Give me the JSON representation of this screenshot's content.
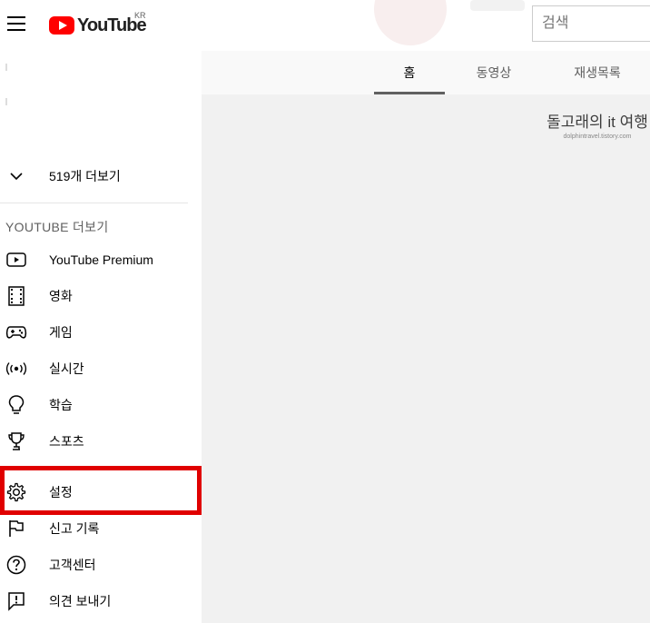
{
  "masthead": {
    "logo_text": "YouTube",
    "country_code": "KR",
    "search_placeholder": "검색"
  },
  "tabs": [
    {
      "label": "홈",
      "active": true
    },
    {
      "label": "동영상",
      "active": false
    },
    {
      "label": "재생목록",
      "active": false
    }
  ],
  "sidebar": {
    "more_subscriptions": "519개 더보기",
    "section_title": "YOUTUBE 더보기",
    "items": [
      {
        "label": "YouTube Premium",
        "icon": "youtube-play-icon"
      },
      {
        "label": "영화",
        "icon": "film-icon"
      },
      {
        "label": "게임",
        "icon": "gamepad-icon"
      },
      {
        "label": "실시간",
        "icon": "live-icon"
      },
      {
        "label": "학습",
        "icon": "lightbulb-icon"
      },
      {
        "label": "스포츠",
        "icon": "trophy-icon"
      }
    ],
    "settings": {
      "label": "설정",
      "icon": "gear-icon"
    },
    "footer_items": [
      {
        "label": "신고 기록",
        "icon": "flag-icon"
      },
      {
        "label": "고객센터",
        "icon": "help-icon"
      },
      {
        "label": "의견 보내기",
        "icon": "feedback-icon"
      }
    ]
  },
  "watermark": {
    "title": "돌고래의 it 여행",
    "url": "dolphintravel.tistory.com"
  },
  "colors": {
    "brand": "#ff0000",
    "highlight_box": "#e00000",
    "content_bg": "#f1f1f1"
  }
}
